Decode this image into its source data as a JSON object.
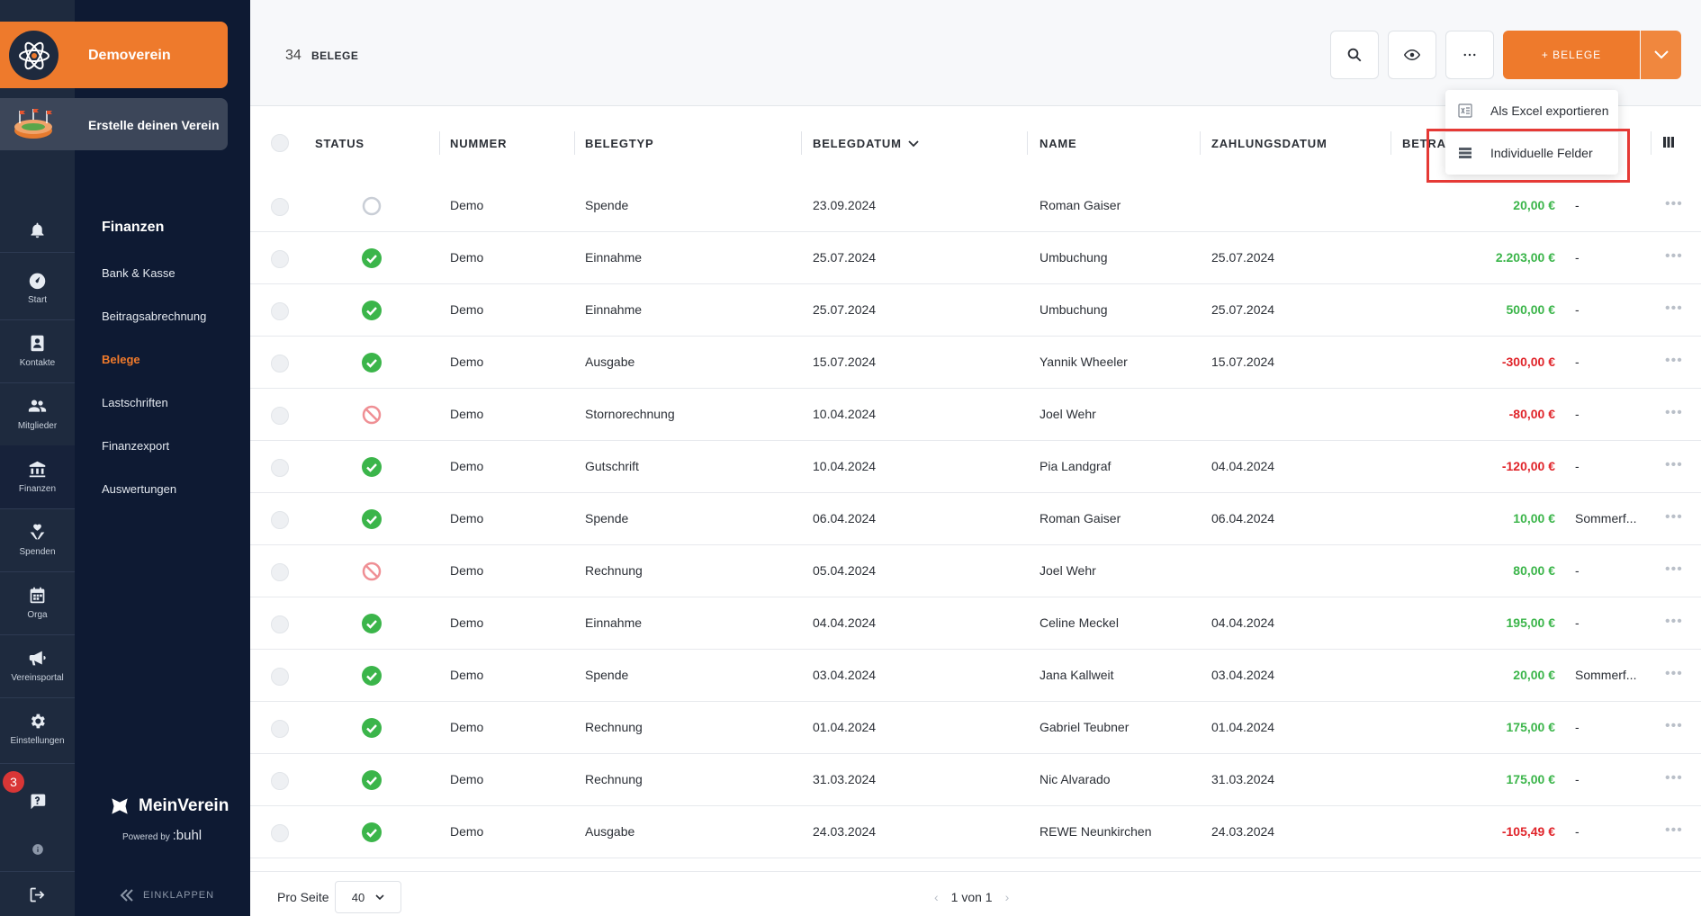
{
  "org": {
    "name": "Demoverein",
    "create_label": "Erstelle deinen Verein"
  },
  "rail": {
    "items": [
      {
        "label": "",
        "icon": "bell-icon"
      },
      {
        "label": "Start",
        "icon": "dashboard-icon"
      },
      {
        "label": "Kontakte",
        "icon": "contacts-icon"
      },
      {
        "label": "Mitglieder",
        "icon": "members-icon"
      },
      {
        "label": "Finanzen",
        "icon": "bank-icon"
      },
      {
        "label": "Spenden",
        "icon": "donation-icon"
      },
      {
        "label": "Orga",
        "icon": "calendar-icon"
      },
      {
        "label": "Vereinsportal",
        "icon": "megaphone-icon"
      },
      {
        "label": "Einstellungen",
        "icon": "gear-icon"
      }
    ],
    "notification_count": "3"
  },
  "nav": {
    "title": "Finanzen",
    "links": [
      "Bank & Kasse",
      "Beitragsabrechnung",
      "Belege",
      "Lastschriften",
      "Finanzexport",
      "Auswertungen"
    ],
    "active": "Belege"
  },
  "brand": {
    "name": "MeinVerein",
    "powered_by": "Powered by",
    "buhl": ":buhl",
    "collapse": "EINKLAPPEN"
  },
  "header": {
    "count": "34",
    "count_label": "BELEGE",
    "add_button": "+ BELEGE"
  },
  "menu": {
    "items": [
      "Als Excel exportieren",
      "Individuelle Felder"
    ],
    "highlighted": "Individuelle Felder"
  },
  "table": {
    "columns": [
      "STATUS",
      "NUMMER",
      "BELEGTYP",
      "BELEGDATUM",
      "NAME",
      "ZAHLUNGSDATUM",
      "BETRAG"
    ],
    "sort_column": "BELEGDATUM",
    "rows": [
      {
        "status": "open",
        "number": "Demo",
        "type": "Spende",
        "date": "23.09.2024",
        "name": "Roman Gaiser",
        "paid": "",
        "amount": "20,00 €",
        "sign": "pos",
        "extra": "-"
      },
      {
        "status": "ok",
        "number": "Demo",
        "type": "Einnahme",
        "date": "25.07.2024",
        "name": "Umbuchung",
        "paid": "25.07.2024",
        "amount": "2.203,00 €",
        "sign": "pos",
        "extra": "-"
      },
      {
        "status": "ok",
        "number": "Demo",
        "type": "Einnahme",
        "date": "25.07.2024",
        "name": "Umbuchung",
        "paid": "25.07.2024",
        "amount": "500,00 €",
        "sign": "pos",
        "extra": "-"
      },
      {
        "status": "ok",
        "number": "Demo",
        "type": "Ausgabe",
        "date": "15.07.2024",
        "name": "Yannik Wheeler",
        "paid": "15.07.2024",
        "amount": "-300,00 €",
        "sign": "neg",
        "extra": "-"
      },
      {
        "status": "cancel",
        "number": "Demo",
        "type": "Stornorechnung",
        "date": "10.04.2024",
        "name": "Joel Wehr",
        "paid": "",
        "amount": "-80,00 €",
        "sign": "neg",
        "extra": "-"
      },
      {
        "status": "ok",
        "number": "Demo",
        "type": "Gutschrift",
        "date": "10.04.2024",
        "name": "Pia Landgraf",
        "paid": "04.04.2024",
        "amount": "-120,00 €",
        "sign": "neg",
        "extra": "-"
      },
      {
        "status": "ok",
        "number": "Demo",
        "type": "Spende",
        "date": "06.04.2024",
        "name": "Roman Gaiser",
        "paid": "06.04.2024",
        "amount": "10,00 €",
        "sign": "pos",
        "extra": "Sommerf..."
      },
      {
        "status": "cancel",
        "number": "Demo",
        "type": "Rechnung",
        "date": "05.04.2024",
        "name": "Joel Wehr",
        "paid": "",
        "amount": "80,00 €",
        "sign": "pos",
        "extra": "-"
      },
      {
        "status": "ok",
        "number": "Demo",
        "type": "Einnahme",
        "date": "04.04.2024",
        "name": "Celine Meckel",
        "paid": "04.04.2024",
        "amount": "195,00 €",
        "sign": "pos",
        "extra": "-"
      },
      {
        "status": "ok",
        "number": "Demo",
        "type": "Spende",
        "date": "03.04.2024",
        "name": "Jana Kallweit",
        "paid": "03.04.2024",
        "amount": "20,00 €",
        "sign": "pos",
        "extra": "Sommerf..."
      },
      {
        "status": "ok",
        "number": "Demo",
        "type": "Rechnung",
        "date": "01.04.2024",
        "name": "Gabriel Teubner",
        "paid": "01.04.2024",
        "amount": "175,00 €",
        "sign": "pos",
        "extra": "-"
      },
      {
        "status": "ok",
        "number": "Demo",
        "type": "Rechnung",
        "date": "31.03.2024",
        "name": "Nic Alvarado",
        "paid": "31.03.2024",
        "amount": "175,00 €",
        "sign": "pos",
        "extra": "-"
      },
      {
        "status": "ok",
        "number": "Demo",
        "type": "Ausgabe",
        "date": "24.03.2024",
        "name": "REWE Neunkirchen",
        "paid": "24.03.2024",
        "amount": "-105,49 €",
        "sign": "neg",
        "extra": "-"
      }
    ]
  },
  "footer": {
    "per_page_label": "Pro Seite",
    "per_page_value": "40",
    "pagination": "1 von 1"
  },
  "colors": {
    "accent": "#ee7a2c",
    "positive": "#3bb54a",
    "negative": "#e0242a",
    "sidebar": "#0e1a33",
    "highlight": "#e53935"
  }
}
